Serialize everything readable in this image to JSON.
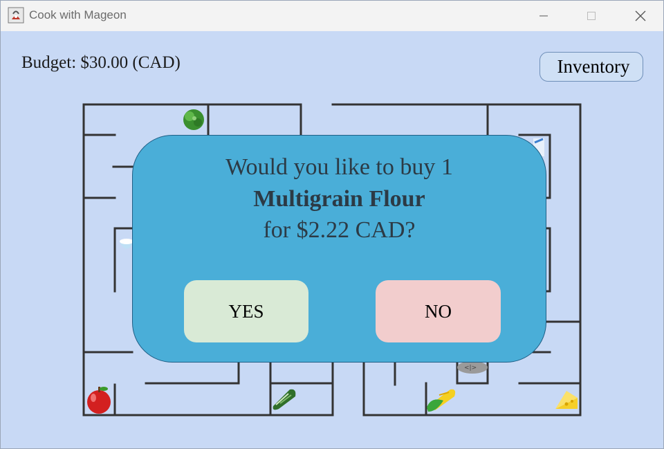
{
  "window": {
    "title": "Cook with Mageon",
    "controls": {
      "minimize": "minimize-icon",
      "maximize": "maximize-icon",
      "close": "close-icon"
    }
  },
  "header": {
    "budget": "Budget: $30.00 (CAD)",
    "inventory_label": "Inventory"
  },
  "maze": {
    "items": [
      "lettuce-icon",
      "milk-icon",
      "rice-bowl-icon",
      "fish-icon",
      "apple-icon",
      "cucumber-icon",
      "corn-icon",
      "cheese-icon"
    ]
  },
  "dialog": {
    "line1": "Would you like to buy 1",
    "item_name": "Multigrain Flour",
    "line3": "for $2.22 CAD?",
    "yes_label": "YES",
    "no_label": "NO"
  },
  "colors": {
    "background": "#c8d9f5",
    "dialog": "#4aaed8",
    "yes": "#d9ead6",
    "no": "#f2cdcd",
    "walls": "#333333"
  }
}
